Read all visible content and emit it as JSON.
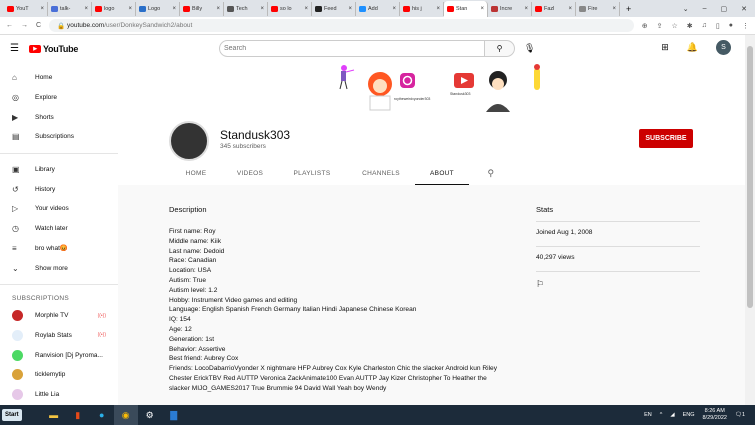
{
  "browser": {
    "tabs": [
      {
        "label": "YouT",
        "fav": "#f00"
      },
      {
        "label": "talk-",
        "fav": "#4a6fd8"
      },
      {
        "label": "logo",
        "fav": "#f00"
      },
      {
        "label": "Logo",
        "fav": "#2a6fc9"
      },
      {
        "label": "Billy",
        "fav": "#f00"
      },
      {
        "label": "Tech",
        "fav": "#555"
      },
      {
        "label": "so lo",
        "fav": "#f00"
      },
      {
        "label": "Feed",
        "fav": "#222"
      },
      {
        "label": "Add",
        "fav": "#1e90ff"
      },
      {
        "label": "his j",
        "fav": "#f00"
      },
      {
        "label": "Stan",
        "fav": "#f00",
        "active": true
      },
      {
        "label": "Incre",
        "fav": "#b33"
      },
      {
        "label": "Fazl",
        "fav": "#f00"
      },
      {
        "label": "Fire",
        "fav": "#888"
      }
    ],
    "url_host": "youtube.com",
    "url_path": "/user/DonkeySandwich2/about"
  },
  "header": {
    "logo": "YouTube",
    "search_placeholder": "Search",
    "avatar_letter": "S"
  },
  "sidebar": {
    "main": [
      {
        "icon": "home-icon",
        "glyph": "⌂",
        "label": "Home"
      },
      {
        "icon": "explore-icon",
        "glyph": "◎",
        "label": "Explore"
      },
      {
        "icon": "shorts-icon",
        "glyph": "▶",
        "label": "Shorts"
      },
      {
        "icon": "subscriptions-icon",
        "glyph": "▤",
        "label": "Subscriptions"
      }
    ],
    "library": [
      {
        "icon": "library-icon",
        "glyph": "▣",
        "label": "Library"
      },
      {
        "icon": "history-icon",
        "glyph": "↺",
        "label": "History"
      },
      {
        "icon": "your-videos-icon",
        "glyph": "▷",
        "label": "Your videos"
      },
      {
        "icon": "watch-later-icon",
        "glyph": "◷",
        "label": "Watch later"
      },
      {
        "icon": "playlist-icon",
        "glyph": "≡",
        "label": "bro what😡"
      },
      {
        "icon": "chevron-down-icon",
        "glyph": "⌄",
        "label": "Show more"
      }
    ],
    "subscriptions_heading": "SUBSCRIPTIONS",
    "subscriptions": [
      {
        "label": "Morphle TV",
        "color": "#c62828",
        "live": "((•))"
      },
      {
        "label": "Roylab Stats",
        "color": "#e3eef9",
        "live": "((•))"
      },
      {
        "label": "Ranvision [Dj Pyroma...",
        "color": "#4cd964"
      },
      {
        "label": "ticklemytip",
        "color": "#d9a23a"
      },
      {
        "label": "Little Lia",
        "color": "#e6c8e8"
      }
    ]
  },
  "banner": {
    "instagram_handle": "roytheweirdvyonder303",
    "youtube_handle": "Standusk303"
  },
  "channel": {
    "name": "Standusk303",
    "subscribers": "345 subscribers",
    "subscribe_label": "SUBSCRIBE",
    "tabs": [
      "HOME",
      "VIDEOS",
      "PLAYLISTS",
      "CHANNELS",
      "ABOUT"
    ],
    "active_tab": "ABOUT"
  },
  "about": {
    "description_heading": "Description",
    "description_lines": [
      "First name: Roy",
      "Middle name: Kiik",
      "Last name: Dedoid",
      "Race: Canadian",
      "Location: USA",
      "Autism: True",
      "Autism level: 1.2",
      "Hobby: Instrument Video games and editing",
      "Language: English Spanish French Germany Italian Hindi Japanese Chinese Korean",
      "IQ: 154",
      "Age: 12",
      "Generation: 1st",
      "Behavior: Assertive",
      "Best friend: Aubrey Cox",
      "Friends: LocoDabarrioVyonder X nightmare HFP Aubrey Cox Kyle Charleston Chic the slacker Android kun Riley Chester ErickTBV Red AUTTP Veronica ZackAnimate100 Evan AUTTP Jay Kizer Christopher To Heather the slacker MIJO_GAMES2017 True Brummie 94 David Wall Yeah boy Wendy"
    ],
    "stats_heading": "Stats",
    "joined": "Joined Aug 1, 2008",
    "views": "40,297 views"
  },
  "taskbar": {
    "start": "Start",
    "lang1": "EN",
    "lang2": "ENG",
    "time": "8:26 AM",
    "date": "8/29/2022",
    "notif": "1"
  }
}
